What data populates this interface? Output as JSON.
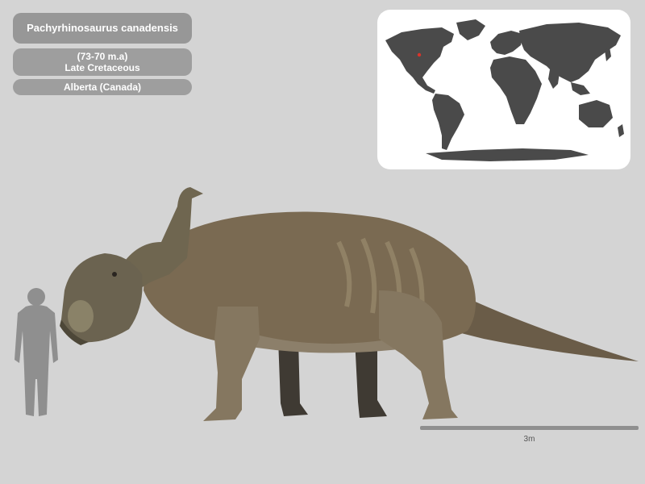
{
  "species": {
    "name": "Pachyrhinosaurus canadensis",
    "age_range": "(73-70 m.a)",
    "period": "Late Cretaceous",
    "location": "Alberta (Canada)"
  },
  "map": {
    "land_color": "#4a4a4a",
    "marker_color": "#d9342b"
  },
  "scale": {
    "label": "3m"
  },
  "colors": {
    "background": "#d4d4d4",
    "label_bg": "#9e9e9e",
    "human_silhouette": "#8f8f8f",
    "dino_body": "#7a6a52"
  }
}
